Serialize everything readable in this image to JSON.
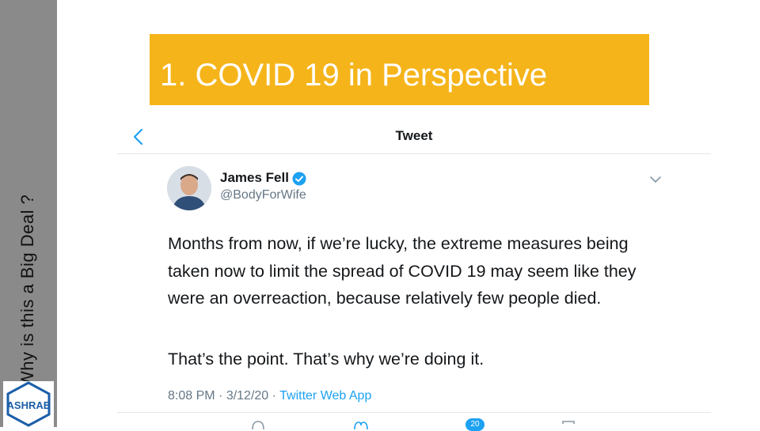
{
  "slide": {
    "side_title": "Why is this a Big Deal ?",
    "logo_text": "ASHRAE",
    "title": "1. COVID 19 in Perspective"
  },
  "tweet": {
    "header_title": "Tweet",
    "author_name": "James Fell",
    "handle": "@Body​ForWife",
    "paragraph1": "Months from now, if we’re lucky, the extreme measures being taken now to limit the spread of COVID 19 may seem like they were an overreaction, because relatively few people died.",
    "paragraph2": "That’s the point. That’s why we’re doing it.",
    "time": "8:08 PM",
    "date": "3/12/20",
    "separator": " · ",
    "source": "Twitter Web App",
    "action_badge": "20"
  },
  "colors": {
    "banner": "#f5b41a",
    "sidebar": "#8a8a8a",
    "twitter_blue": "#1da1f2"
  },
  "icons": [
    "back-chevron-icon",
    "verified-icon",
    "chevron-down-icon",
    "reply-icon",
    "retweet-icon",
    "like-icon",
    "share-icon"
  ]
}
